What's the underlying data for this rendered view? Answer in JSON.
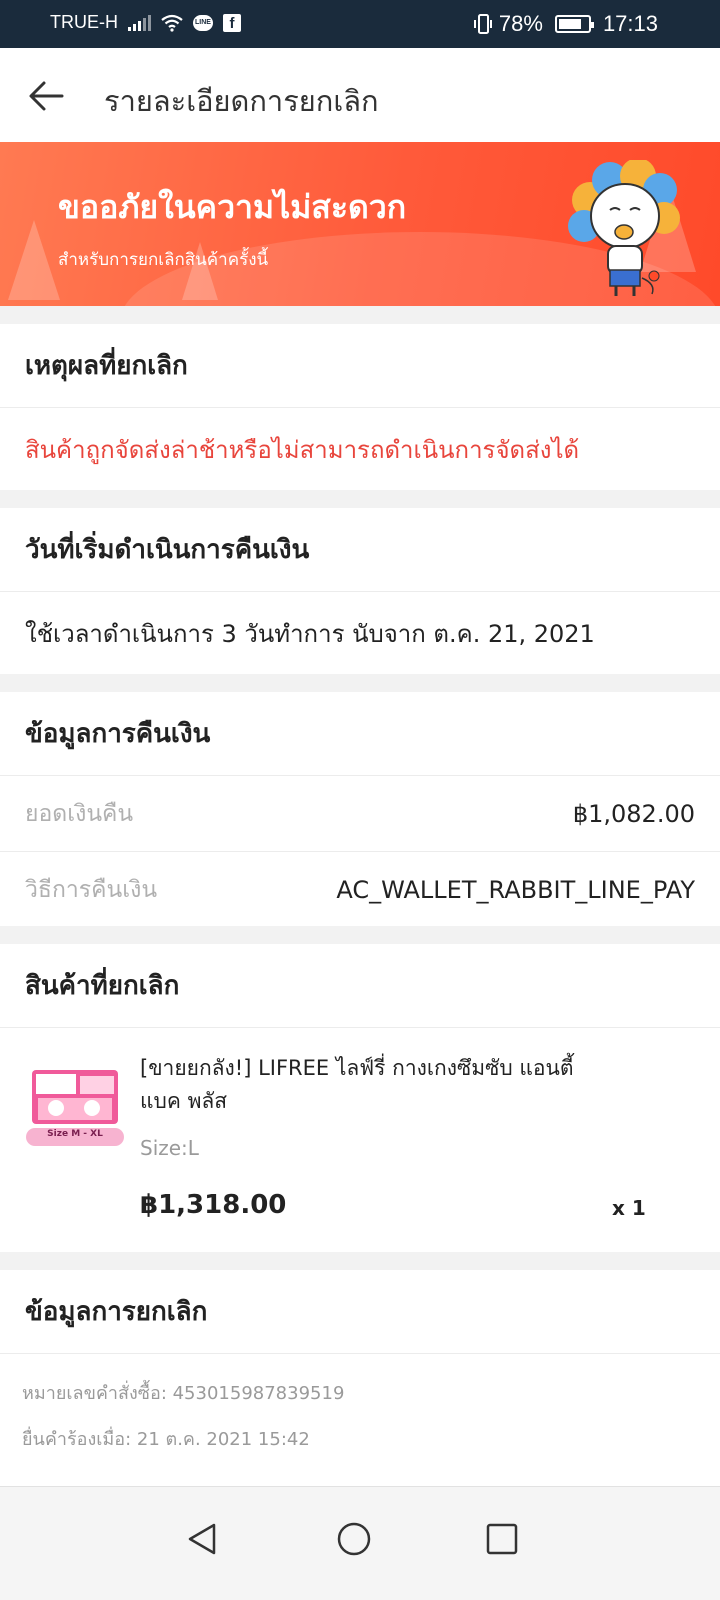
{
  "status_bar": {
    "carrier": "TRUE-H",
    "line_badge": "LINE",
    "fb_badge": "f",
    "battery_percent": "78%",
    "battery_level": 0.78,
    "time": "17:13"
  },
  "header": {
    "title": "รายละเอียดการยกเลิก"
  },
  "banner": {
    "title": "ขออภัยในความไม่สะดวก",
    "subtitle": "สำหรับการยกเลิกสินค้าครั้งนี้"
  },
  "reason": {
    "heading": "เหตุผลที่ยกเลิก",
    "text": "สินค้าถูกจัดส่งล่าช้าหรือไม่สามารถดำเนินการจัดส่งได้"
  },
  "refund_start": {
    "heading": "วันที่เริ่มดำเนินการคืนเงิน",
    "text": "ใช้เวลาดำเนินการ 3 วันทำการ นับจาก ต.ค. 21, 2021"
  },
  "refund_info": {
    "heading": "ข้อมูลการคืนเงิน",
    "rows": [
      {
        "label": "ยอดเงินคืน",
        "value": "฿1,082.00"
      },
      {
        "label": "วิธีการคืนเงิน",
        "value": "AC_WALLET_RABBIT_LINE_PAY"
      }
    ]
  },
  "cancelled_items": {
    "heading": "สินค้าที่ยกเลิก",
    "product": {
      "name": "[ขายยกลัง!] LIFREE ไลฟ์รี่ กางเกงซึมซับ แอนตี้แบค พลัส",
      "size": "Size:L",
      "price": "฿1,318.00",
      "qty": "x 1",
      "image_label": "Size M - XL"
    }
  },
  "cancel_info": {
    "heading": "ข้อมูลการยกเลิก",
    "order_no": "หมายเลขคำสั่งซื้อ: 453015987839519",
    "requested_at": "ยื่นคำร้องเมื่อ: 21 ต.ค. 2021 15:42"
  },
  "colors": {
    "accent": "#ee4d2d",
    "reason_text": "#e8453c",
    "status_bar_bg": "#1a2b3c"
  },
  "icons": [
    "back-arrow-icon",
    "signal-icon",
    "wifi-icon",
    "vibrate-icon",
    "battery-icon",
    "nav-back-icon",
    "nav-home-icon",
    "nav-recents-icon"
  ]
}
